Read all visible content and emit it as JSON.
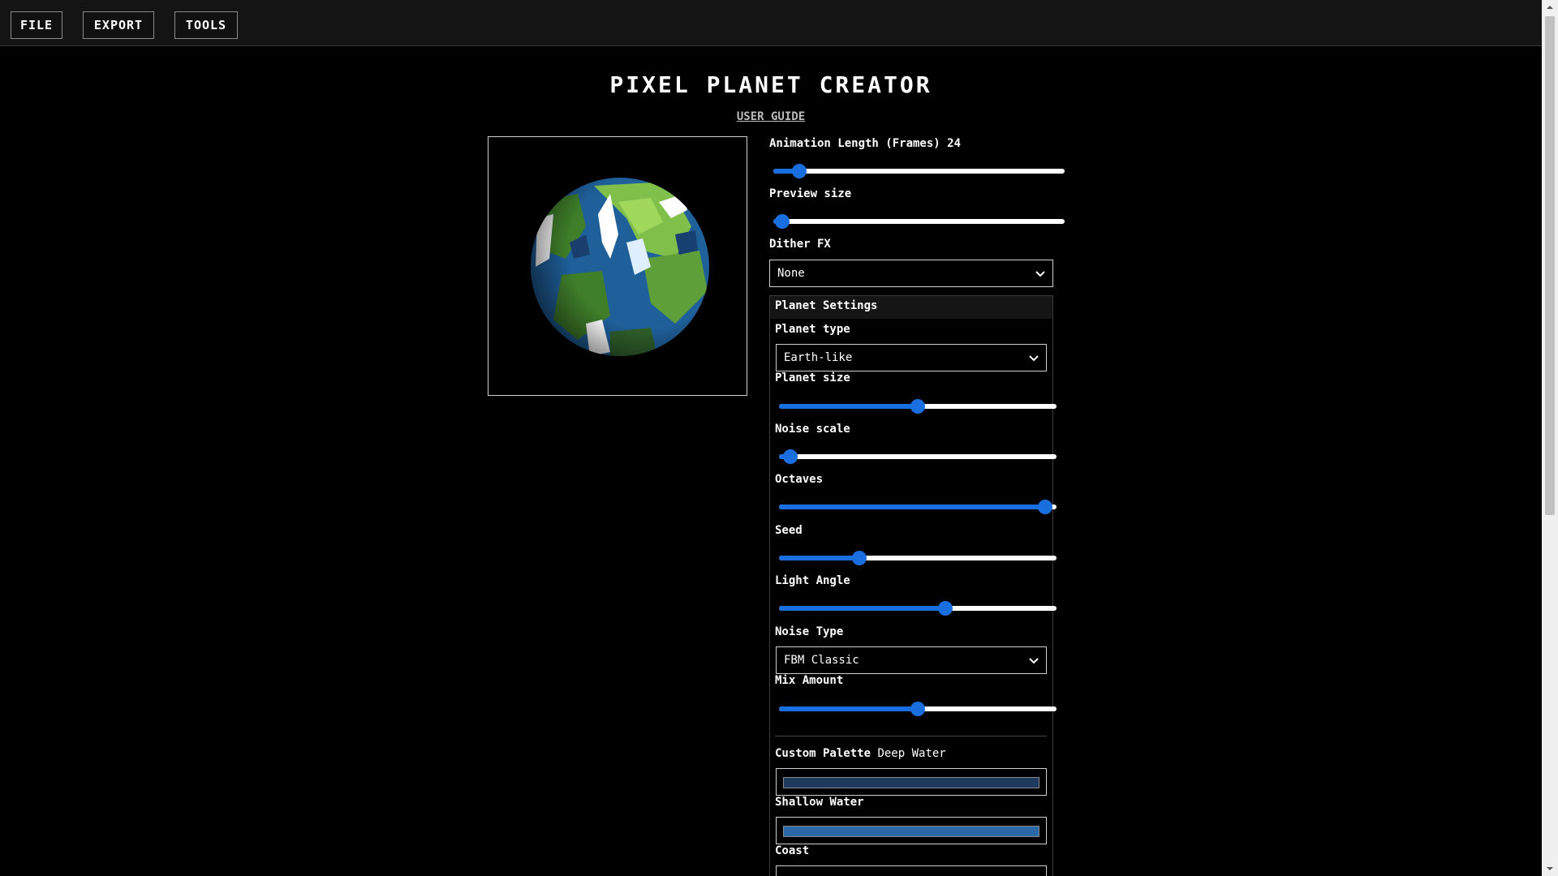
{
  "menu": {
    "file": "FILE",
    "export": "EXPORT",
    "tools": "TOOLS"
  },
  "header": {
    "title": "PIXEL PLANET CREATOR",
    "guide": "USER GUIDE"
  },
  "controls": {
    "animation_label": "Animation Length (Frames)",
    "animation_value": "24",
    "animation_pos": 0.09,
    "preview_label": "Preview size",
    "preview_pos": 0.03,
    "dither_label": "Dither FX",
    "dither_value": "None"
  },
  "planet": {
    "heading": "Planet Settings",
    "type_label": "Planet type",
    "type_value": "Earth-like",
    "size_label": "Planet size",
    "size_pos": 0.5,
    "noise_scale_label": "Noise scale",
    "noise_scale_pos": 0.04,
    "octaves_label": "Octaves",
    "octaves_pos": 0.96,
    "seed_label": "Seed",
    "seed_pos": 0.29,
    "light_label": "Light Angle",
    "light_pos": 0.6,
    "noise_type_label": "Noise Type",
    "noise_type_value": "FBM Classic",
    "mix_label": "Mix Amount",
    "mix_pos": 0.5
  },
  "palette": {
    "heading": "Custom Palette",
    "deep_label": "Deep Water",
    "deep_color": "#1e3a5f",
    "shallow_label": "Shallow Water",
    "shallow_color": "#2a6aa8",
    "coast_label": "Coast"
  },
  "colors": {
    "accent": "#1a6fe0"
  }
}
